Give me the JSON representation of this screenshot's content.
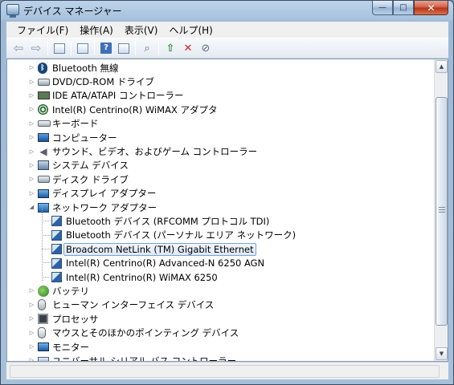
{
  "window": {
    "title": "デバイス マネージャー",
    "controls": {
      "minimize": "—",
      "maximize": "□",
      "close": "✕"
    }
  },
  "menu": [
    {
      "label": "ファイル(F)"
    },
    {
      "label": "操作(A)"
    },
    {
      "label": "表示(V)"
    },
    {
      "label": "ヘルプ(H)"
    }
  ],
  "toolbar": {
    "buttons": [
      "back-icon",
      "forward-icon",
      "console-tree-icon",
      "properties-icon",
      "help-icon",
      "action-pane-icon",
      "scan-hardware-icon",
      "update-driver-icon",
      "uninstall-icon",
      "disable-icon"
    ]
  },
  "tree": {
    "categories": [
      {
        "label": "Bluetooth 無線",
        "icon": "bluetooth-icon",
        "expander": "▷"
      },
      {
        "label": "DVD/CD-ROM ドライブ",
        "icon": "dvd-drive-icon",
        "expander": "▷"
      },
      {
        "label": "IDE ATA/ATAPI コントローラー",
        "icon": "ide-controller-icon",
        "expander": "▷"
      },
      {
        "label": "Intel(R) Centrino(R) WiMAX アダプタ",
        "icon": "wimax-adapter-icon",
        "expander": "▷"
      },
      {
        "label": "キーボード",
        "icon": "keyboard-icon",
        "expander": "▷"
      },
      {
        "label": "コンピューター",
        "icon": "computer-icon",
        "expander": "▷"
      },
      {
        "label": "サウンド、ビデオ、およびゲーム コントローラー",
        "icon": "sound-icon",
        "expander": "▷"
      },
      {
        "label": "システム デバイス",
        "icon": "system-device-icon",
        "expander": "▷"
      },
      {
        "label": "ディスク ドライブ",
        "icon": "disk-drive-icon",
        "expander": "▷"
      },
      {
        "label": "ディスプレイ アダプター",
        "icon": "display-adapter-icon",
        "expander": "▷"
      },
      {
        "label": "ネットワーク アダプター",
        "icon": "network-adapter-icon",
        "expander": "◢"
      }
    ],
    "network_children": [
      {
        "label": "Bluetooth デバイス (RFCOMM プロトコル TDI)"
      },
      {
        "label": "Bluetooth デバイス (パーソナル エリア ネットワーク)"
      },
      {
        "label": "Broadcom NetLink (TM) Gigabit Ethernet",
        "selected": true
      },
      {
        "label": "Intel(R) Centrino(R) Advanced-N 6250 AGN"
      },
      {
        "label": "Intel(R) Centrino(R) WiMAX 6250"
      }
    ],
    "more_categories": [
      {
        "label": "バッテリ",
        "icon": "battery-icon",
        "expander": "▷"
      },
      {
        "label": "ヒューマン インターフェイス デバイス",
        "icon": "hid-icon",
        "expander": "▷"
      },
      {
        "label": "プロセッサ",
        "icon": "processor-icon",
        "expander": "▷"
      },
      {
        "label": "マウスとそのほかのポインティング デバイス",
        "icon": "mouse-icon",
        "expander": "▷"
      },
      {
        "label": "モニター",
        "icon": "monitor-icon",
        "expander": "▷"
      },
      {
        "label": "ユニバーサル シリアル バス コントローラー",
        "icon": "usb-controller-icon",
        "expander": "▷"
      }
    ]
  },
  "scrollbar": {
    "up": "▲",
    "down": "▼",
    "position_fraction": 0.1
  },
  "colors": {
    "selection_border": "#7da2ce",
    "window_frame": "#a9c3de"
  }
}
